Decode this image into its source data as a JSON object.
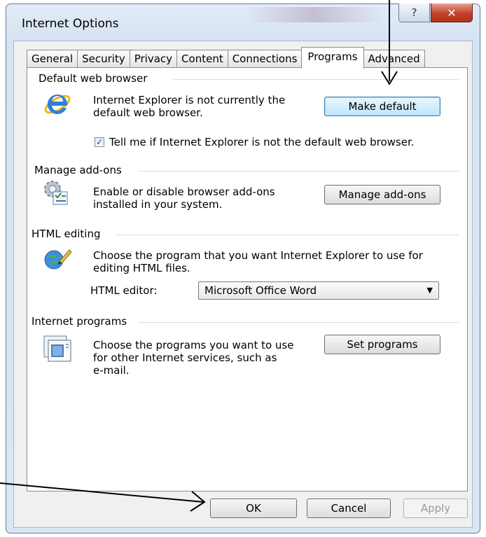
{
  "window": {
    "title": "Internet Options",
    "help_glyph": "?",
    "close_glyph": "✕"
  },
  "tabs": [
    {
      "label": "General"
    },
    {
      "label": "Security"
    },
    {
      "label": "Privacy"
    },
    {
      "label": "Content"
    },
    {
      "label": "Connections"
    },
    {
      "label": "Programs"
    },
    {
      "label": "Advanced"
    }
  ],
  "active_tab": "Programs",
  "default_browser": {
    "title": "Default web browser",
    "description_line1": "Internet Explorer is not currently the",
    "description_line2": "default web browser.",
    "button": "Make default",
    "checkbox_label": "Tell me if Internet Explorer is not the default web browser.",
    "checkbox_checked": true
  },
  "addons": {
    "title": "Manage add-ons",
    "description_line1": "Enable or disable browser add-ons",
    "description_line2": "installed in your system.",
    "button": "Manage add-ons"
  },
  "html_editing": {
    "title": "HTML editing",
    "description_line1": "Choose the program that you want Internet Explorer to use for",
    "description_line2": "editing HTML files.",
    "editor_label": "HTML editor:",
    "editor_value": "Microsoft Office Word"
  },
  "internet_programs": {
    "title": "Internet programs",
    "description_line1": "Choose the programs you want to use",
    "description_line2": "for other Internet services, such as",
    "description_line3": "e-mail.",
    "button": "Set programs"
  },
  "footer": {
    "ok": "OK",
    "cancel": "Cancel",
    "apply": "Apply"
  },
  "colors": {
    "accent_button": "#bee6fd",
    "close_button": "#c0402b"
  }
}
